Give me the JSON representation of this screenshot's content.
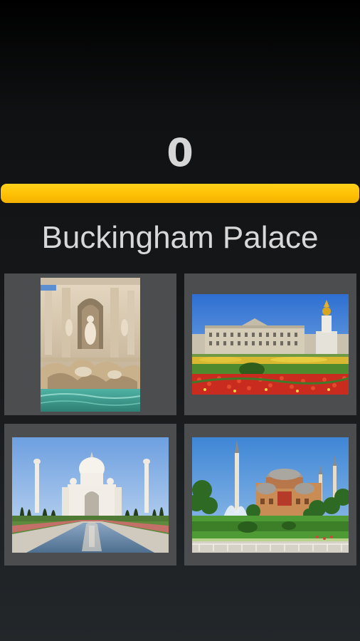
{
  "game": {
    "score": "0",
    "progress_fraction": 1.0,
    "question": "Buckingham Palace"
  },
  "colors": {
    "progress_bar": "#ffc107",
    "tile_background": "#4b4d4f",
    "text": "#d8d8d8"
  },
  "choices": [
    {
      "icon": "trevi-fountain-photo"
    },
    {
      "icon": "buckingham-palace-photo"
    },
    {
      "icon": "taj-mahal-photo"
    },
    {
      "icon": "hagia-sophia-photo"
    }
  ]
}
